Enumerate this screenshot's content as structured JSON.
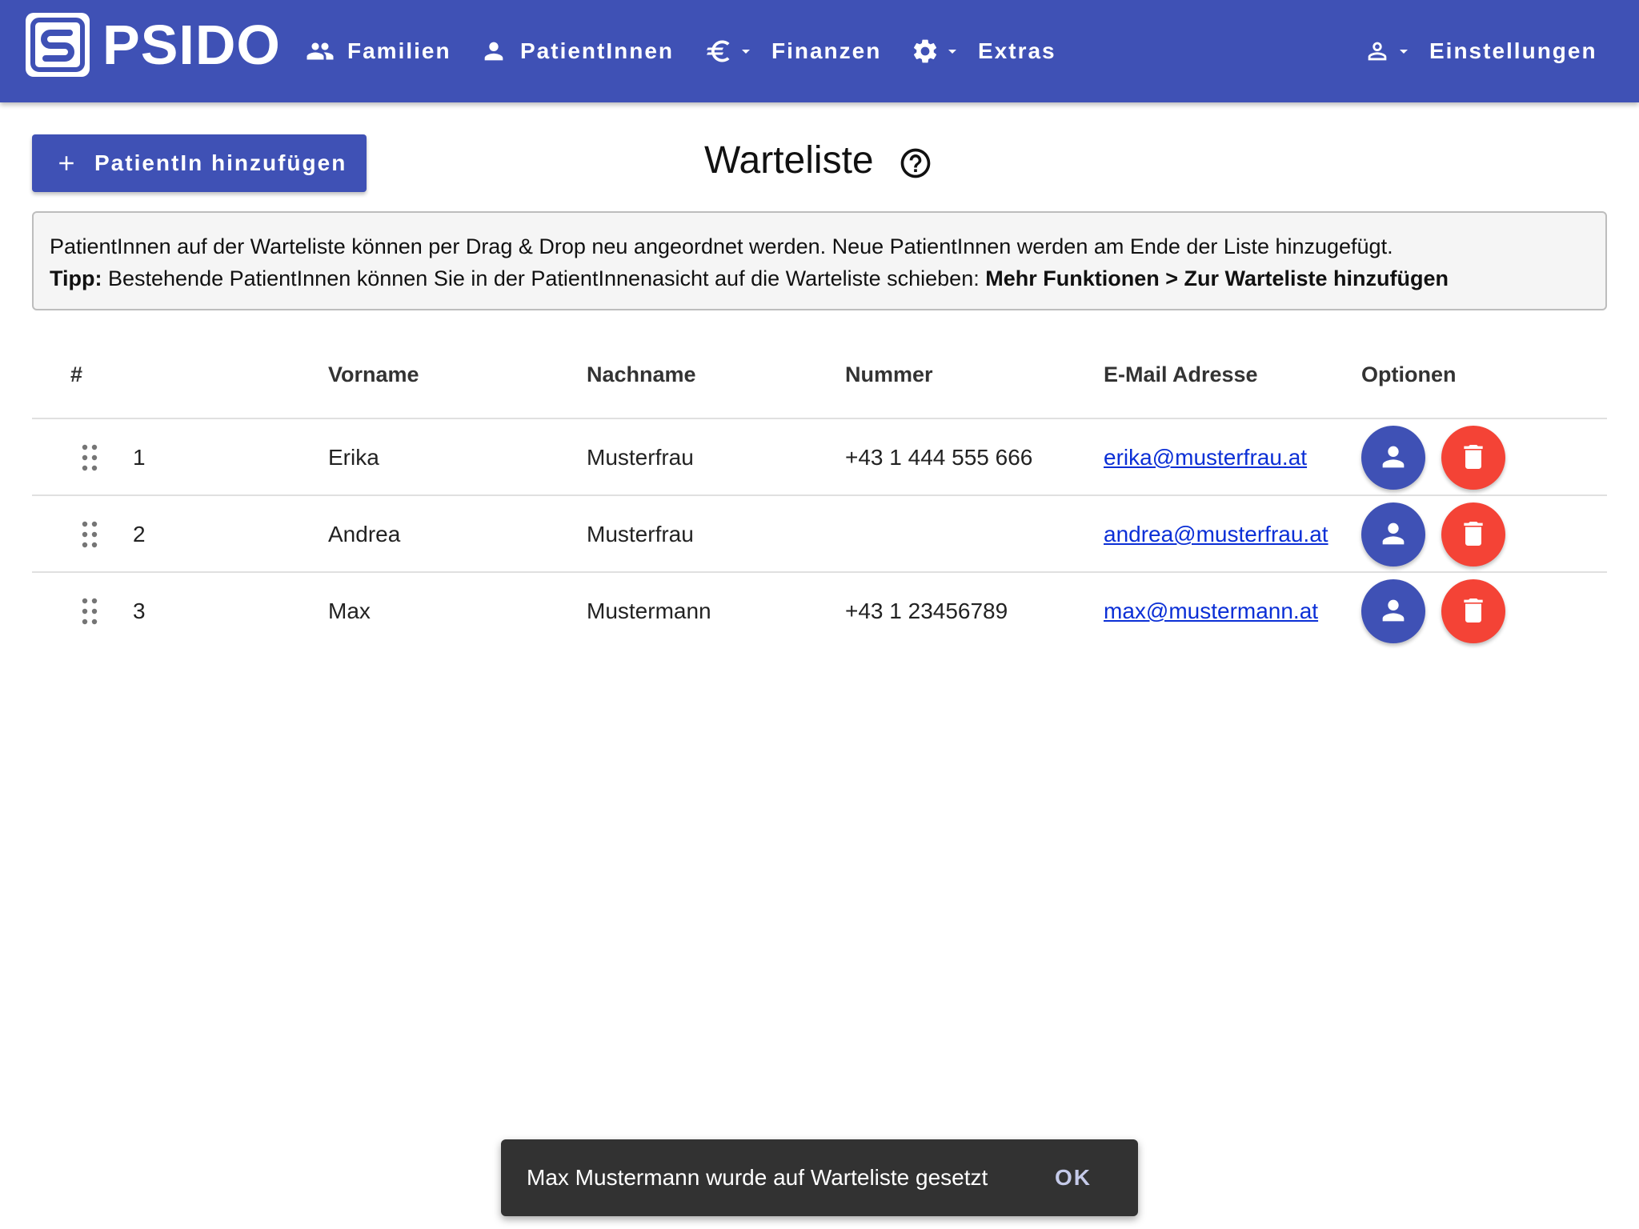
{
  "app": {
    "logo_text": "PSIDO"
  },
  "nav": {
    "families_label": "Familien",
    "patients_label": "PatientInnen",
    "finance_label": "Finanzen",
    "extras_label": "Extras",
    "settings_label": "Einstellungen"
  },
  "toolbar": {
    "add_label": "PatientIn hinzufügen"
  },
  "page": {
    "title": "Warteliste"
  },
  "info": {
    "line1": "PatientInnen auf der Warteliste können per Drag & Drop neu angeordnet werden. Neue PatientInnen werden am Ende der Liste hinzugefügt.",
    "tip_label": "Tipp:",
    "tip_text": " Bestehende PatientInnen können Sie in der PatientInnenasicht auf die Warteliste schieben: ",
    "tip_path": "Mehr Funktionen > Zur Warteliste hinzufügen"
  },
  "table": {
    "headers": {
      "index": "#",
      "first_name": "Vorname",
      "last_name": "Nachname",
      "number": "Nummer",
      "email": "E-Mail Adresse",
      "options": "Optionen"
    },
    "rows": [
      {
        "index": "1",
        "first_name": "Erika",
        "last_name": "Musterfrau",
        "number": "+43 1 444 555 666",
        "email": "erika@musterfrau.at"
      },
      {
        "index": "2",
        "first_name": "Andrea",
        "last_name": "Musterfrau",
        "number": "",
        "email": "andrea@musterfrau.at"
      },
      {
        "index": "3",
        "first_name": "Max",
        "last_name": "Mustermann",
        "number": "+43 1 23456789",
        "email": "max@mustermann.at"
      }
    ]
  },
  "snackbar": {
    "message": "Max Mustermann wurde auf Warteliste gesetzt",
    "action": "OK"
  },
  "colors": {
    "primary": "#3f51b5",
    "danger": "#f44336",
    "snackbar_bg": "#323232"
  }
}
